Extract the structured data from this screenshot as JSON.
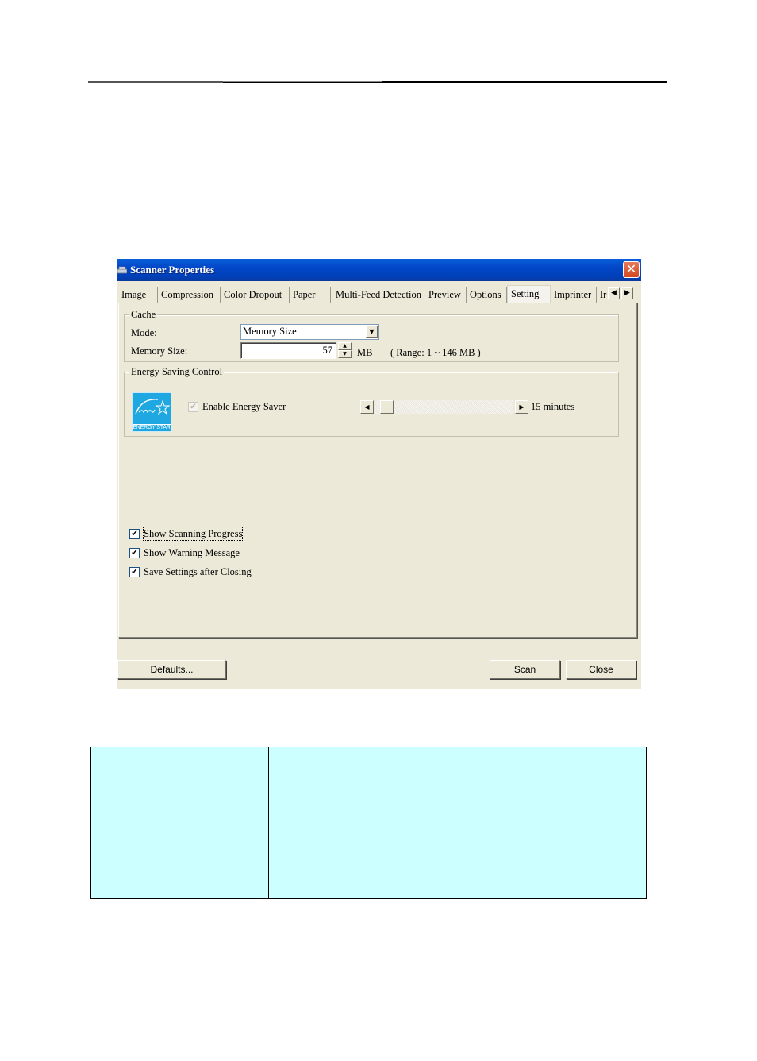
{
  "window": {
    "title": "Scanner Properties",
    "icon": "scanner-icon",
    "close_glyph": "✕"
  },
  "tabs": {
    "items": [
      {
        "label": "Image",
        "active": false
      },
      {
        "label": "Compression",
        "active": false
      },
      {
        "label": "Color Dropout",
        "active": false
      },
      {
        "label": "Paper",
        "active": false
      },
      {
        "label": "Multi-Feed Detection",
        "active": false
      },
      {
        "label": "Preview",
        "active": false
      },
      {
        "label": "Options",
        "active": false
      },
      {
        "label": "Setting",
        "active": true
      },
      {
        "label": "Imprinter",
        "active": false
      },
      {
        "label": "Ir",
        "active": false
      }
    ],
    "scroll_left_glyph": "◀",
    "scroll_right_glyph": "▶"
  },
  "cache": {
    "legend": "Cache",
    "mode_label": "Mode:",
    "mode_value": "Memory Size",
    "memory_label": "Memory Size:",
    "memory_value": "57",
    "memory_unit": "MB",
    "range_text": "( Range: 1 ~ 146 MB )",
    "spin_up": "▲",
    "spin_down": "▼",
    "dropdown_glyph": "▼"
  },
  "energy": {
    "legend": "Energy Saving Control",
    "logo_text": "ENERGY STAR",
    "enable_label": "Enable Energy Saver",
    "enable_checked": true,
    "enable_disabled": true,
    "slider_value_text": "15 minutes",
    "slider_position_fraction": 0.0,
    "slider_left_glyph": "◀",
    "slider_right_glyph": "▶"
  },
  "options": [
    {
      "label": "Show Scanning Progress",
      "checked": true,
      "focused": true
    },
    {
      "label": "Show Warning Message",
      "checked": true,
      "focused": false
    },
    {
      "label": "Save Settings after Closing",
      "checked": true,
      "focused": false
    }
  ],
  "check_glyph": "✔",
  "buttons": {
    "defaults": "Defaults...",
    "scan": "Scan",
    "close": "Close"
  }
}
